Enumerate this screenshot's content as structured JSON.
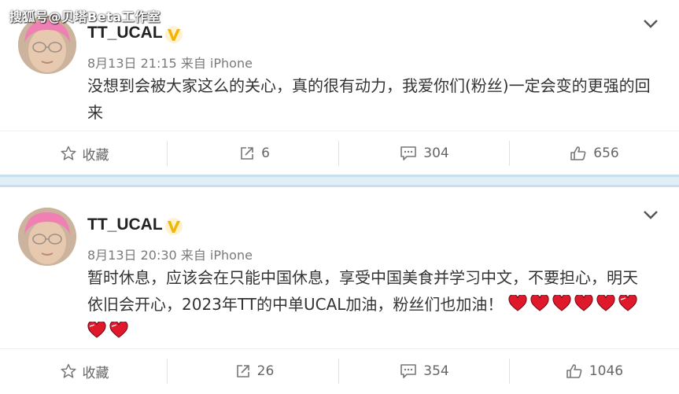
{
  "watermark": "搜狐号@贝塔Beta工作室",
  "posts": [
    {
      "username": "TT_UCAL",
      "date": "8月13日 21:15",
      "source": "来自 iPhone",
      "text_line1": "没想到会被大家这么的关心，真的很有动力，我爱你们(粉丝)一定会变的更强的回",
      "text_line2": "来",
      "actions": {
        "favorite": "收藏",
        "repost": "6",
        "comment": "304",
        "like": "656"
      }
    },
    {
      "username": "TT_UCAL",
      "date": "8月13日 20:30",
      "source": "来自 iPhone",
      "text_line1": "暂时休息，应该会在只能中国休息，享受中国美食并学习中文，不要担心，明天",
      "text_line2": "依旧会开心，2023年TT的中单UCAL加油，粉丝们也加油！",
      "actions": {
        "favorite": "收藏",
        "repost": "26",
        "comment": "354",
        "like": "1046"
      }
    }
  ],
  "icons": {
    "verified": "verified-v-icon",
    "favorite": "star-icon",
    "repost": "repost-icon",
    "comment": "comment-icon",
    "like": "thumbs-up-icon",
    "menu": "chevron-down-icon",
    "heart": "heart-emoji-icon"
  },
  "colors": {
    "verified": "#f5b400",
    "heart": "#e0182b",
    "divider": "#dfeef7"
  }
}
